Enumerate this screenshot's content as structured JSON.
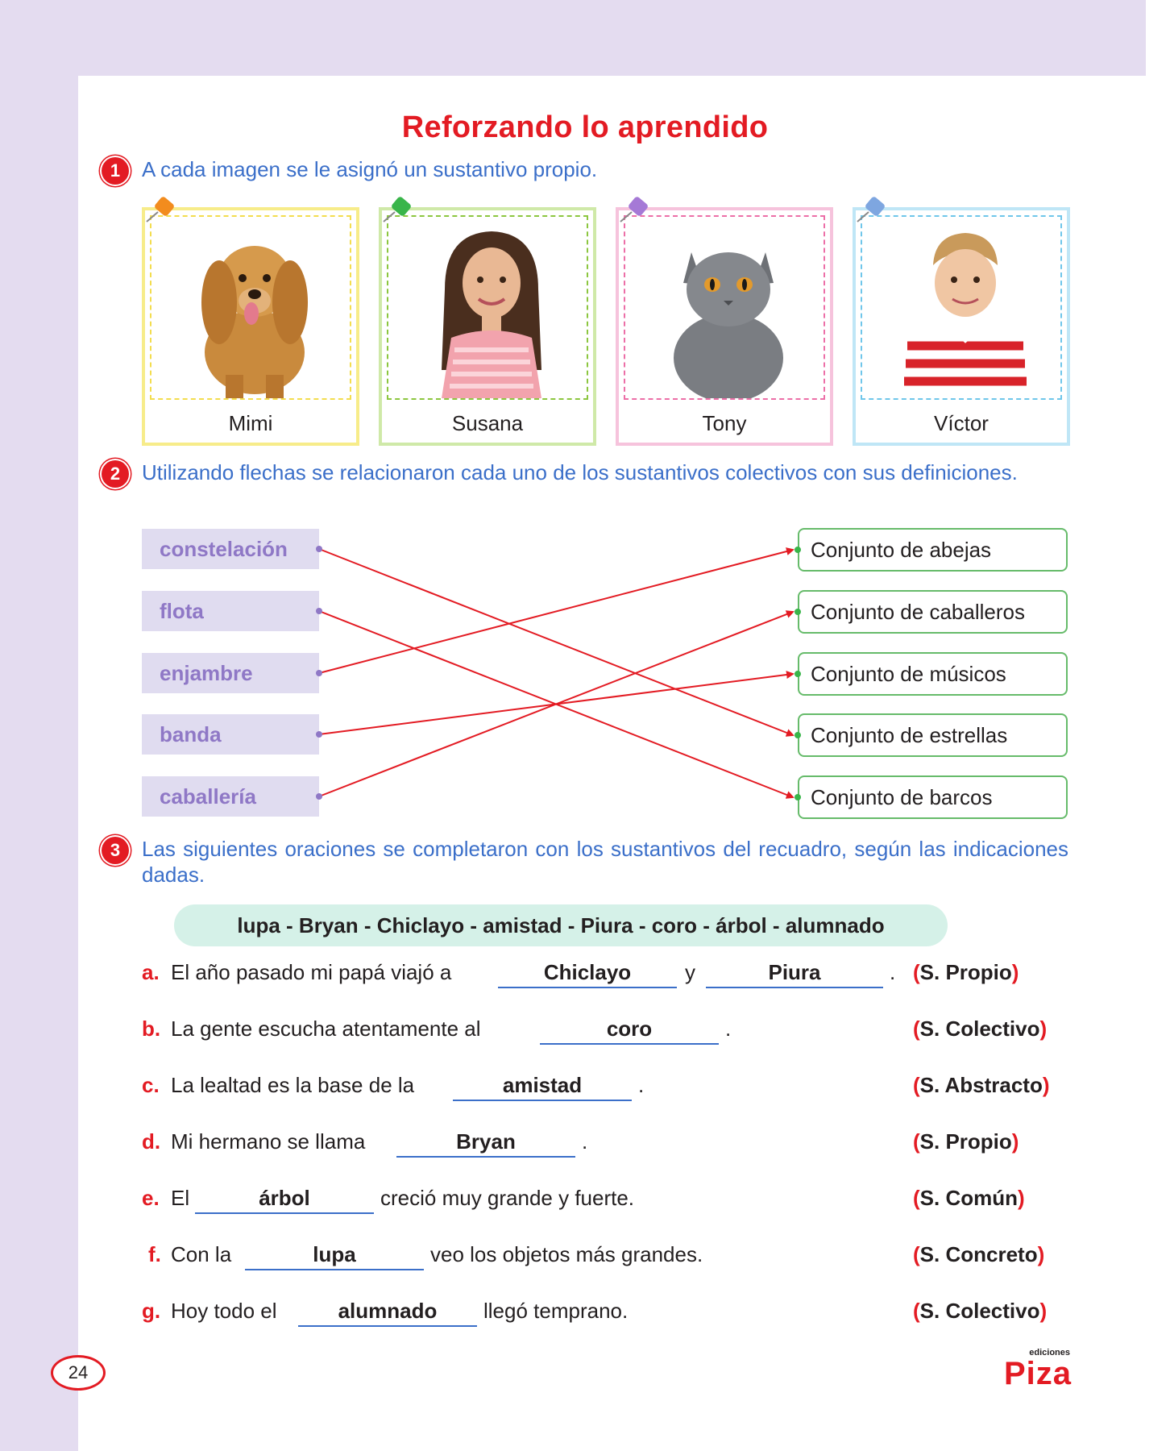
{
  "title": "Reforzando lo aprendido",
  "section1": {
    "number": "1",
    "instruction": "A cada imagen se le asignó un sustantivo propio.",
    "cards": [
      {
        "name": "Mimi",
        "frame_color": "#f7ec8a",
        "dash_color": "#f3dd4e",
        "pin_color": "#f28c1e"
      },
      {
        "name": "Susana",
        "frame_color": "#cfe9a8",
        "dash_color": "#8cc63f",
        "pin_color": "#39b54a"
      },
      {
        "name": "Tony",
        "frame_color": "#f6c3dc",
        "dash_color": "#ec6fa7",
        "pin_color": "#a579d6"
      },
      {
        "name": "Víctor",
        "frame_color": "#bfe6f6",
        "dash_color": "#6fc6ea",
        "pin_color": "#7ea6e0"
      }
    ]
  },
  "section2": {
    "number": "2",
    "instruction": "Utilizando flechas se relacionaron cada uno de los sustantivos colectivos con sus definiciones.",
    "terms": [
      "constelación",
      "flota",
      "enjambre",
      "banda",
      "caballería"
    ],
    "definitions": [
      "Conjunto de abejas",
      "Conjunto de caballeros",
      "Conjunto de músicos",
      "Conjunto de estrellas",
      "Conjunto de barcos"
    ],
    "matches": [
      3,
      4,
      0,
      2,
      1
    ],
    "arrow_color": "#e31b23"
  },
  "section3": {
    "number": "3",
    "instruction": "Las siguientes oraciones se completaron con los sustantivos del recuadro, según las indicaciones dadas.",
    "word_bank": "lupa - Bryan - Chiclayo - amistad - Piura - coro - árbol - alumnado",
    "sentences": [
      {
        "letter": "a.",
        "before": "El año pasado mi papá viajó a",
        "answer": "Chiclayo",
        "middle": "y",
        "answer2": "Piura",
        "after": ".",
        "category": "S. Propio"
      },
      {
        "letter": "b.",
        "before": "La gente escucha atentamente al",
        "answer": "coro",
        "after": ".",
        "category": "S. Colectivo"
      },
      {
        "letter": "c.",
        "before": "La lealtad es la base de la",
        "answer": "amistad",
        "after": ".",
        "category": "S. Abstracto"
      },
      {
        "letter": "d.",
        "before": "Mi hermano se llama",
        "answer": "Bryan",
        "after": ".",
        "category": "S. Propio"
      },
      {
        "letter": "e.",
        "before": "El",
        "answer": "árbol",
        "after": "creció muy grande y fuerte.",
        "category": "S. Común"
      },
      {
        "letter": "f.",
        "before": "Con la",
        "answer": "lupa",
        "after": "veo los objetos más grandes.",
        "category": "S. Concreto"
      },
      {
        "letter": "g.",
        "before": "Hoy todo el",
        "answer": "alumnado",
        "after": "llegó temprano.",
        "category": "S. Colectivo"
      }
    ]
  },
  "footer": {
    "page_number": "24",
    "brand_small": "ediciones",
    "brand": "Piza"
  }
}
